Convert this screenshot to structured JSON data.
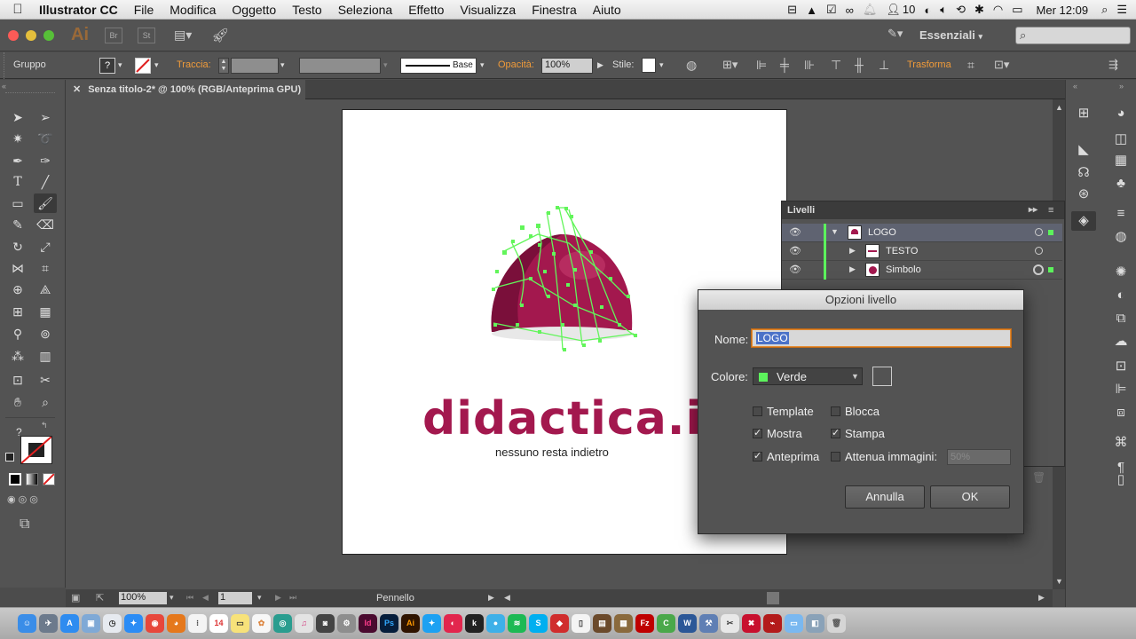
{
  "menubar": {
    "app_name": "Illustrator CC",
    "menus": [
      "File",
      "Modifica",
      "Oggetto",
      "Testo",
      "Seleziona",
      "Effetto",
      "Visualizza",
      "Finestra",
      "Aiuto"
    ],
    "status_count": "10",
    "clock": "Mer 12:09"
  },
  "appbar": {
    "ai_badge": "Ai",
    "br_label": "Br",
    "st_label": "St",
    "workspace": "Essenziali"
  },
  "control": {
    "selection_type": "Gruppo",
    "stroke_label": "Traccia:",
    "stroke_profile": "Base",
    "opacity_label": "Opacità:",
    "opacity_value": "100%",
    "style_label": "Stile:",
    "transform_label": "Trasforma"
  },
  "document": {
    "tab_title": "Senza titolo-2* @ 100% (RGB/Anteprima GPU)"
  },
  "artwork": {
    "brand": "didactica.it",
    "tagline": "nessuno resta indietro",
    "colors": {
      "brand": "#a3184e",
      "brand_dark": "#6e1038",
      "path_green": "#62f55a"
    }
  },
  "status": {
    "zoom": "100%",
    "page": "1",
    "tool": "Pennello"
  },
  "layers_panel": {
    "title": "Livelli",
    "rows": [
      {
        "name": "LOGO",
        "expanded": true,
        "selected": true
      },
      {
        "name": "TESTO",
        "expanded": false,
        "selected": false
      },
      {
        "name": "Simbolo",
        "expanded": false,
        "selected": false
      }
    ]
  },
  "dialog": {
    "title": "Opzioni livello",
    "name_label": "Nome:",
    "name_value": "LOGO",
    "color_label": "Colore:",
    "color_value": "Verde",
    "color_swatch": "#5cf25c",
    "options": {
      "template": {
        "label": "Template",
        "checked": false
      },
      "blocca": {
        "label": "Blocca",
        "checked": false
      },
      "mostra": {
        "label": "Mostra",
        "checked": true
      },
      "stampa": {
        "label": "Stampa",
        "checked": true
      },
      "anteprima": {
        "label": "Anteprima",
        "checked": true
      },
      "attenua": {
        "label": "Attenua immagini:",
        "checked": false,
        "value": "50%"
      }
    },
    "cancel_label": "Annulla",
    "ok_label": "OK"
  },
  "dock_apps": [
    "Finder",
    "Launchpad",
    "App Store",
    "Preview",
    "Safari",
    "Chrome",
    "Firefox",
    "Notes",
    "Calendar",
    "Stickies",
    "Photos",
    "iTunes",
    "FaceTime",
    "System Preferences",
    "InDesign",
    "Photoshop",
    "Illustrator",
    "Twitter",
    "Lightroom",
    "Kindle",
    "Skype",
    "Spotify",
    "Skype Alt",
    "Evernote",
    "Messages",
    "Pages",
    "FileZilla",
    "Clipboard",
    "Word",
    "Xcode",
    "Scissors",
    "Acrobat",
    "Downloads",
    "Trash"
  ]
}
